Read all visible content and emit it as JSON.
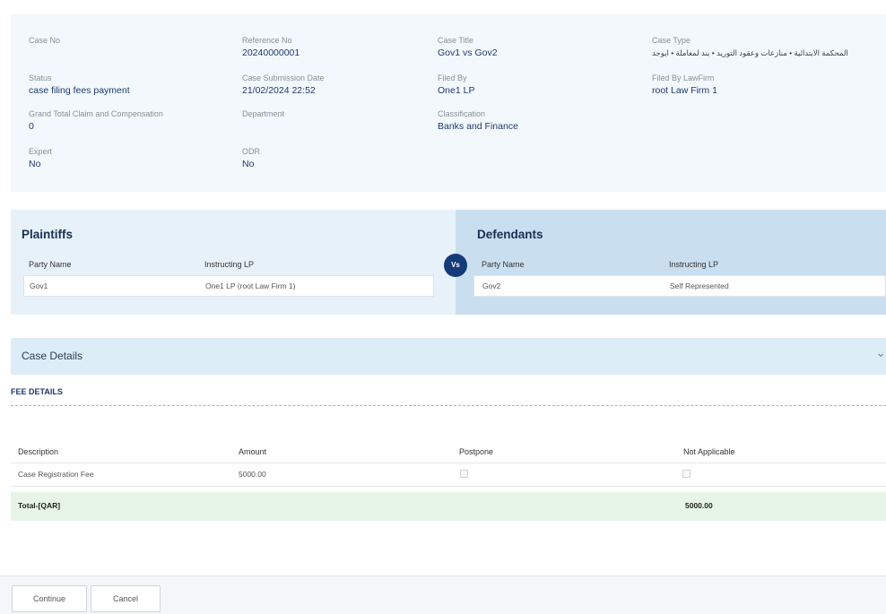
{
  "case": {
    "case_no": {
      "label": "Case No",
      "value": ""
    },
    "reference_no": {
      "label": "Reference No",
      "value": "20240000001"
    },
    "case_title": {
      "label": "Case Title",
      "value": "Gov1 vs Gov2"
    },
    "case_type": {
      "label": "Case Type",
      "value": "المحكمة الابتدائية • منازعات وعقود التوريد • بند لمعاملة • ايوجد"
    },
    "status": {
      "label": "Status",
      "value": "case filing fees payment"
    },
    "submission_date": {
      "label": "Case Submission Date",
      "value": "21/02/2024 22:52"
    },
    "filed_by": {
      "label": "Filed By",
      "value": "One1 LP"
    },
    "filed_by_lawfirm": {
      "label": "Filed By LawFirm",
      "value": "root Law Firm 1"
    },
    "grand_total": {
      "label": "Grand Total Claim and Compensation",
      "value": "0"
    },
    "department": {
      "label": "Department",
      "value": ""
    },
    "classification": {
      "label": "Classification",
      "value": "Banks and Finance"
    },
    "expert": {
      "label": "Expert",
      "value": "No"
    },
    "odr": {
      "label": "ODR",
      "value": "No"
    }
  },
  "parties": {
    "vs_label": "Vs",
    "plaintiffs": {
      "title": "Plaintiffs",
      "col_party": "Party Name",
      "col_lp": "Instructing LP",
      "rows": [
        {
          "party": "Gov1",
          "lp": "One1 LP (root Law Firm 1)"
        }
      ]
    },
    "defendants": {
      "title": "Defendants",
      "col_party": "Party Name",
      "col_lp": "Instructing LP",
      "rows": [
        {
          "party": "Gov2",
          "lp": "Self Represented"
        }
      ]
    }
  },
  "case_details": {
    "title": "Case Details",
    "chevron_icon": "chevron-down-icon"
  },
  "fees": {
    "title": "FEE DETAILS",
    "headers": {
      "description": "Description",
      "amount": "Amount",
      "postpone": "Postpone",
      "not_applicable": "Not Applicable"
    },
    "rows": [
      {
        "description": "Case Registration Fee",
        "amount": "5000.00",
        "postpone": false,
        "not_applicable": false
      }
    ],
    "total_label": "Total-[QAR]",
    "total_value": "5000.00"
  },
  "footer": {
    "continue_label": "Continue",
    "cancel_label": "Cancel"
  },
  "colors": {
    "link_value": "#1e3a6e",
    "vs_badge": "#143a78",
    "total_row": "#e6f5e6",
    "summary_bg": "#f2f8fc"
  }
}
